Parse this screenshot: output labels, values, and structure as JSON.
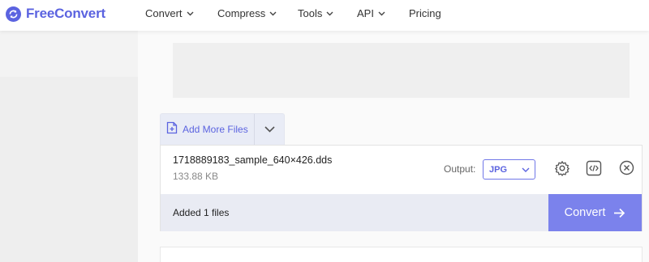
{
  "brand": {
    "name": "FreeConvert",
    "accent": "#5b63e0"
  },
  "nav": {
    "items": [
      {
        "label": "Convert",
        "has_dropdown": true
      },
      {
        "label": "Compress",
        "has_dropdown": true
      },
      {
        "label": "Tools",
        "has_dropdown": true
      },
      {
        "label": "API",
        "has_dropdown": true
      },
      {
        "label": "Pricing",
        "has_dropdown": false
      }
    ]
  },
  "uploader": {
    "add_more_label": "Add More Files",
    "add_more_icon": "file-plus-icon",
    "toggle_icon": "chevron-down-icon"
  },
  "file": {
    "name": "1718889183_sample_640×426.dds",
    "size": "133.88 KB",
    "output_label": "Output:",
    "output_format": "JPG",
    "actions": [
      "gear-icon",
      "code-icon",
      "close-circle-icon"
    ]
  },
  "status": {
    "added_text": "Added 1 files",
    "convert_label": "Convert",
    "convert_color": "#7b82ec"
  }
}
